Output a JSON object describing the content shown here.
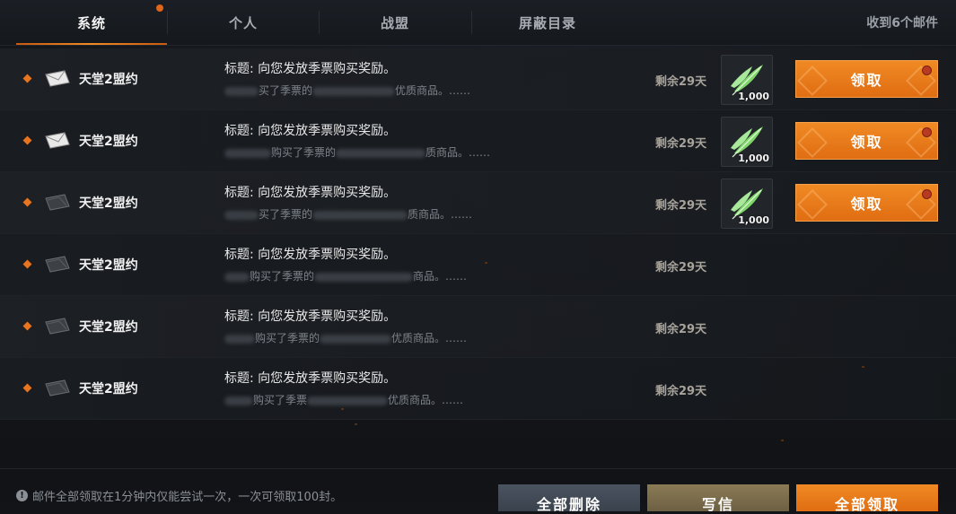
{
  "tabs": [
    {
      "label": "系统",
      "active": true,
      "has_dot": true
    },
    {
      "label": "个人",
      "active": false
    },
    {
      "label": "战盟",
      "active": false
    },
    {
      "label": "屏蔽目录",
      "active": false
    }
  ],
  "mail_count": "收到6个邮件",
  "mails": [
    {
      "sender": "天堂2盟约",
      "title": "标题: 向您发放季票购买奖励。",
      "preview_a": "买了季票的",
      "preview_b": "优质商品。……",
      "remaining": "剩余29天",
      "opened": false,
      "attachment": {
        "icon": "green-feather-icon",
        "qty": "1,000"
      },
      "claim_label": "领取"
    },
    {
      "sender": "天堂2盟约",
      "title": "标题: 向您发放季票购买奖励。",
      "preview_a": "购买了季票的",
      "preview_b": "质商品。……",
      "remaining": "剩余29天",
      "opened": false,
      "attachment": {
        "icon": "green-feather-icon",
        "qty": "1,000"
      },
      "claim_label": "领取"
    },
    {
      "sender": "天堂2盟约",
      "title": "标题: 向您发放季票购买奖励。",
      "preview_a": "买了季票的",
      "preview_b": "质商品。……",
      "remaining": "剩余29天",
      "opened": true,
      "attachment": {
        "icon": "green-feather-icon",
        "qty": "1,000"
      },
      "claim_label": "领取"
    },
    {
      "sender": "天堂2盟约",
      "title": "标题: 向您发放季票购买奖励。",
      "preview_a": "购买了季票的",
      "preview_b": "商品。……",
      "remaining": "剩余29天",
      "opened": true,
      "attachment": null
    },
    {
      "sender": "天堂2盟约",
      "title": "标题: 向您发放季票购买奖励。",
      "preview_a": "购买了季票的",
      "preview_b": "优质商品。……",
      "remaining": "剩余29天",
      "opened": true,
      "attachment": null
    },
    {
      "sender": "天堂2盟约",
      "title": "标题: 向您发放季票购买奖励。",
      "preview_a": "购买了季票",
      "preview_b": "优质商品。……",
      "remaining": "剩余29天",
      "opened": true,
      "attachment": null
    }
  ],
  "footer": {
    "notice": "邮件全部领取在1分钟内仅能尝试一次，一次可领取100封。",
    "delete_all": "全部删除",
    "write": "写信",
    "claim_all": "全部领取"
  },
  "colors": {
    "accent": "#f08a24",
    "bullet": "#e8741f"
  }
}
